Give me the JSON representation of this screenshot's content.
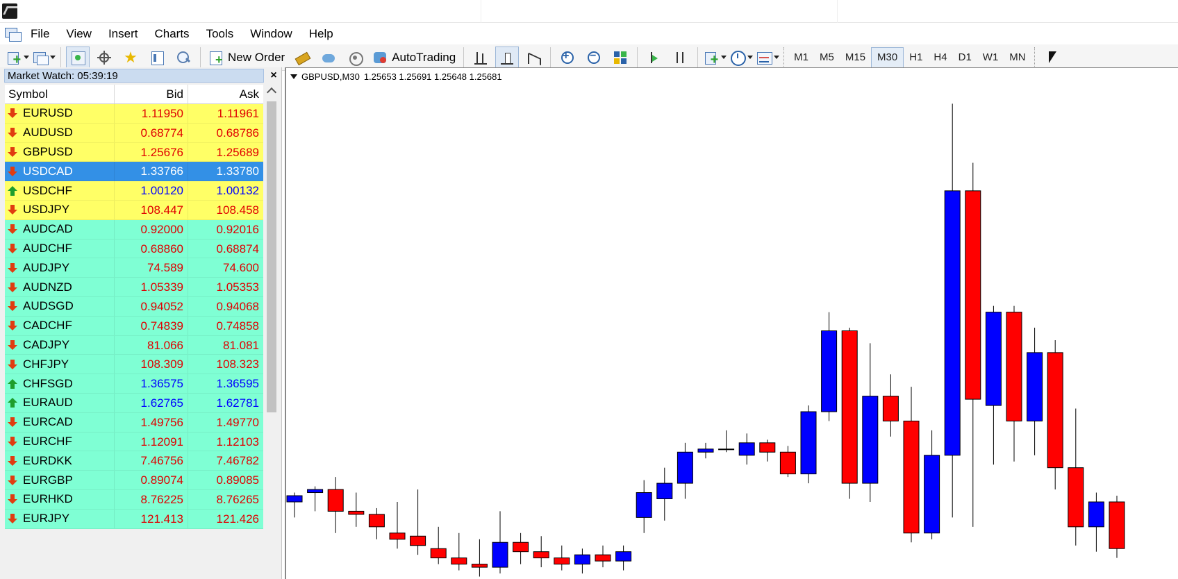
{
  "menu": {
    "items": [
      "File",
      "View",
      "Insert",
      "Charts",
      "Tools",
      "Window",
      "Help"
    ]
  },
  "toolbar": {
    "new_order_label": "New Order",
    "autotrading_label": "AutoTrading",
    "timeframes": [
      "M1",
      "M5",
      "M15",
      "M30",
      "H1",
      "H4",
      "D1",
      "W1",
      "MN"
    ],
    "active_timeframe": "M30"
  },
  "market_watch": {
    "title": "Market Watch: 05:39:19",
    "close_label": "×",
    "columns": {
      "symbol": "Symbol",
      "bid": "Bid",
      "ask": "Ask"
    },
    "rows": [
      {
        "symbol": "EURUSD",
        "bid": "1.11950",
        "ask": "1.11961",
        "dir": "down",
        "bg": "yellow"
      },
      {
        "symbol": "AUDUSD",
        "bid": "0.68774",
        "ask": "0.68786",
        "dir": "down",
        "bg": "yellow"
      },
      {
        "symbol": "GBPUSD",
        "bid": "1.25676",
        "ask": "1.25689",
        "dir": "down",
        "bg": "yellow"
      },
      {
        "symbol": "USDCAD",
        "bid": "1.33766",
        "ask": "1.33780",
        "dir": "down",
        "bg": "selected"
      },
      {
        "symbol": "USDCHF",
        "bid": "1.00120",
        "ask": "1.00132",
        "dir": "up",
        "bg": "yellow"
      },
      {
        "symbol": "USDJPY",
        "bid": "108.447",
        "ask": "108.458",
        "dir": "down",
        "bg": "yellow"
      },
      {
        "symbol": "AUDCAD",
        "bid": "0.92000",
        "ask": "0.92016",
        "dir": "down",
        "bg": "aqua"
      },
      {
        "symbol": "AUDCHF",
        "bid": "0.68860",
        "ask": "0.68874",
        "dir": "down",
        "bg": "aqua"
      },
      {
        "symbol": "AUDJPY",
        "bid": "74.589",
        "ask": "74.600",
        "dir": "down",
        "bg": "aqua"
      },
      {
        "symbol": "AUDNZD",
        "bid": "1.05339",
        "ask": "1.05353",
        "dir": "down",
        "bg": "aqua"
      },
      {
        "symbol": "AUDSGD",
        "bid": "0.94052",
        "ask": "0.94068",
        "dir": "down",
        "bg": "aqua"
      },
      {
        "symbol": "CADCHF",
        "bid": "0.74839",
        "ask": "0.74858",
        "dir": "down",
        "bg": "aqua"
      },
      {
        "symbol": "CADJPY",
        "bid": "81.066",
        "ask": "81.081",
        "dir": "down",
        "bg": "aqua"
      },
      {
        "symbol": "CHFJPY",
        "bid": "108.309",
        "ask": "108.323",
        "dir": "down",
        "bg": "aqua"
      },
      {
        "symbol": "CHFSGD",
        "bid": "1.36575",
        "ask": "1.36595",
        "dir": "up",
        "bg": "aqua"
      },
      {
        "symbol": "EURAUD",
        "bid": "1.62765",
        "ask": "1.62781",
        "dir": "up",
        "bg": "aqua"
      },
      {
        "symbol": "EURCAD",
        "bid": "1.49756",
        "ask": "1.49770",
        "dir": "down",
        "bg": "aqua"
      },
      {
        "symbol": "EURCHF",
        "bid": "1.12091",
        "ask": "1.12103",
        "dir": "down",
        "bg": "aqua"
      },
      {
        "symbol": "EURDKK",
        "bid": "7.46756",
        "ask": "7.46782",
        "dir": "down",
        "bg": "aqua"
      },
      {
        "symbol": "EURGBP",
        "bid": "0.89074",
        "ask": "0.89085",
        "dir": "down",
        "bg": "aqua"
      },
      {
        "symbol": "EURHKD",
        "bid": "8.76225",
        "ask": "8.76265",
        "dir": "down",
        "bg": "aqua"
      },
      {
        "symbol": "EURJPY",
        "bid": "121.413",
        "ask": "121.426",
        "dir": "down",
        "bg": "aqua"
      }
    ]
  },
  "chart": {
    "info_symbol": "GBPUSD,M30",
    "info_ohlc": "1.25653 1.25691 1.25648 1.25681",
    "bull_color": "#0000ff",
    "bear_color": "#ff0000",
    "candles": [
      {
        "o": 1.253,
        "h": 1.2533,
        "l": 1.2525,
        "c": 1.2532
      },
      {
        "o": 1.2533,
        "h": 1.2535,
        "l": 1.2527,
        "c": 1.2534
      },
      {
        "o": 1.2534,
        "h": 1.2538,
        "l": 1.252,
        "c": 1.2527
      },
      {
        "o": 1.2527,
        "h": 1.2533,
        "l": 1.2522,
        "c": 1.2526
      },
      {
        "o": 1.2526,
        "h": 1.2528,
        "l": 1.2518,
        "c": 1.2522
      },
      {
        "o": 1.252,
        "h": 1.253,
        "l": 1.2515,
        "c": 1.2518
      },
      {
        "o": 1.2519,
        "h": 1.2534,
        "l": 1.2513,
        "c": 1.2516
      },
      {
        "o": 1.2515,
        "h": 1.2522,
        "l": 1.251,
        "c": 1.2512
      },
      {
        "o": 1.2512,
        "h": 1.252,
        "l": 1.2508,
        "c": 1.251
      },
      {
        "o": 1.251,
        "h": 1.2518,
        "l": 1.2506,
        "c": 1.2509
      },
      {
        "o": 1.2509,
        "h": 1.2527,
        "l": 1.2507,
        "c": 1.2517
      },
      {
        "o": 1.2517,
        "h": 1.252,
        "l": 1.251,
        "c": 1.2514
      },
      {
        "o": 1.2514,
        "h": 1.2519,
        "l": 1.2509,
        "c": 1.2512
      },
      {
        "o": 1.2512,
        "h": 1.2516,
        "l": 1.2508,
        "c": 1.251
      },
      {
        "o": 1.251,
        "h": 1.2515,
        "l": 1.2507,
        "c": 1.2513
      },
      {
        "o": 1.2513,
        "h": 1.2516,
        "l": 1.2509,
        "c": 1.2511
      },
      {
        "o": 1.2511,
        "h": 1.2516,
        "l": 1.2508,
        "c": 1.2514
      },
      {
        "o": 1.2525,
        "h": 1.2537,
        "l": 1.252,
        "c": 1.2533
      },
      {
        "o": 1.2531,
        "h": 1.2541,
        "l": 1.2524,
        "c": 1.2536
      },
      {
        "o": 1.2536,
        "h": 1.2549,
        "l": 1.2531,
        "c": 1.2546
      },
      {
        "o": 1.2546,
        "h": 1.2549,
        "l": 1.2544,
        "c": 1.2547
      },
      {
        "o": 1.2547,
        "h": 1.2553,
        "l": 1.2546,
        "c": 1.2547
      },
      {
        "o": 1.2545,
        "h": 1.2552,
        "l": 1.2542,
        "c": 1.2549
      },
      {
        "o": 1.2549,
        "h": 1.255,
        "l": 1.2543,
        "c": 1.2546
      },
      {
        "o": 1.2546,
        "h": 1.2548,
        "l": 1.2538,
        "c": 1.2539
      },
      {
        "o": 1.2539,
        "h": 1.2561,
        "l": 1.2536,
        "c": 1.2559
      },
      {
        "o": 1.2559,
        "h": 1.2591,
        "l": 1.2556,
        "c": 1.2585
      },
      {
        "o": 1.2585,
        "h": 1.2586,
        "l": 1.2531,
        "c": 1.2536
      },
      {
        "o": 1.2536,
        "h": 1.2581,
        "l": 1.253,
        "c": 1.2564
      },
      {
        "o": 1.2564,
        "h": 1.2571,
        "l": 1.2551,
        "c": 1.2556
      },
      {
        "o": 1.2556,
        "h": 1.2567,
        "l": 1.2517,
        "c": 1.252
      },
      {
        "o": 1.252,
        "h": 1.2553,
        "l": 1.2518,
        "c": 1.2545
      },
      {
        "o": 1.2545,
        "h": 1.2658,
        "l": 1.2525,
        "c": 1.263
      },
      {
        "o": 1.263,
        "h": 1.2639,
        "l": 1.2522,
        "c": 1.2563
      },
      {
        "o": 1.2561,
        "h": 1.2593,
        "l": 1.2542,
        "c": 1.2591
      },
      {
        "o": 1.2591,
        "h": 1.2593,
        "l": 1.2543,
        "c": 1.2556
      },
      {
        "o": 1.2556,
        "h": 1.2586,
        "l": 1.2545,
        "c": 1.2578
      },
      {
        "o": 1.2578,
        "h": 1.2582,
        "l": 1.2534,
        "c": 1.2541
      },
      {
        "o": 1.2541,
        "h": 1.256,
        "l": 1.2516,
        "c": 1.2522
      },
      {
        "o": 1.2522,
        "h": 1.2533,
        "l": 1.2514,
        "c": 1.253
      },
      {
        "o": 1.253,
        "h": 1.2532,
        "l": 1.2512,
        "c": 1.2515
      }
    ]
  }
}
